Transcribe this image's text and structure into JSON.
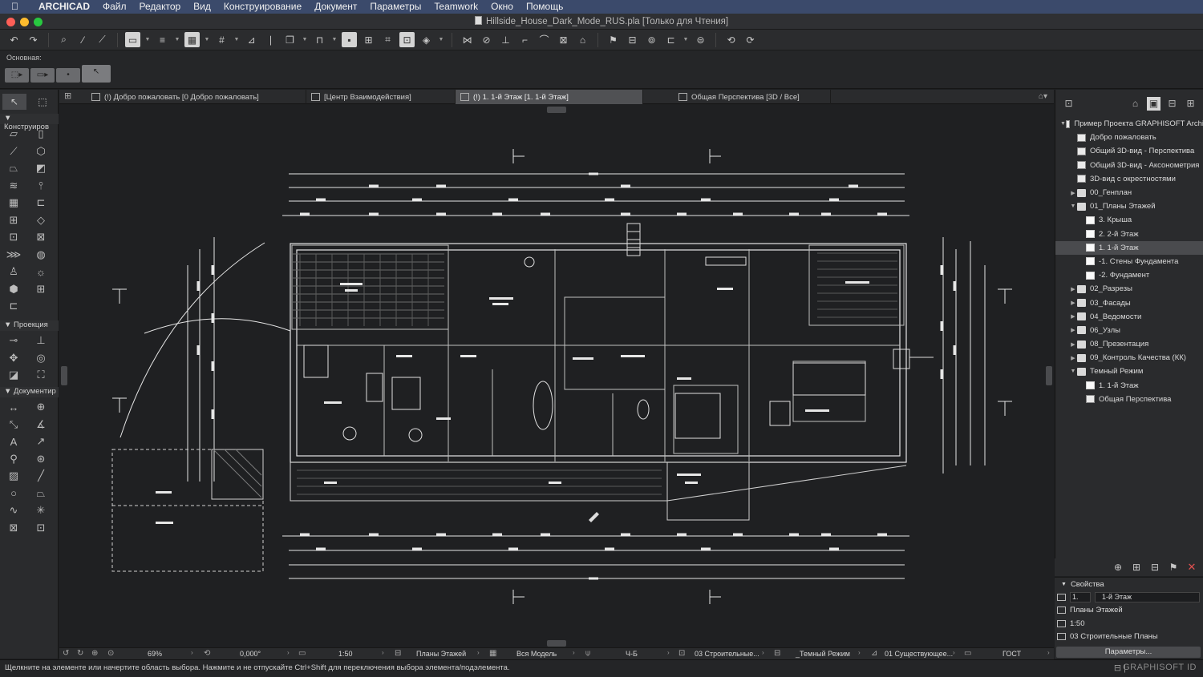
{
  "menubar": {
    "app": "ARCHICAD",
    "items": [
      "Файл",
      "Редактор",
      "Вид",
      "Конструирование",
      "Документ",
      "Параметры",
      "Teamwork",
      "Окно",
      "Помощь"
    ]
  },
  "window": {
    "title": "Hillside_House_Dark_Mode_RUS.pla [Только для Чтения]"
  },
  "infobox": {
    "label": "Основная:"
  },
  "toolbox": {
    "sections": [
      "Конструиров",
      "Проекция",
      "Документир"
    ]
  },
  "tabs": [
    {
      "label": "(!) Добро пожаловать [0 Добро пожаловать]",
      "active": false
    },
    {
      "label": "[Центр Взаимодействия]",
      "active": false
    },
    {
      "label": "(!) 1. 1-й Этаж [1. 1-й Этаж]",
      "active": true
    },
    {
      "label": "Общая Перспектива [3D / Все]",
      "active": false
    }
  ],
  "navigator": {
    "tree": [
      {
        "label": "Пример Проекта GRAPHISOFT Archi",
        "level": 0,
        "arrow": "▼",
        "icon": "view"
      },
      {
        "label": "Добро пожаловать",
        "level": 1,
        "arrow": "",
        "icon": "view"
      },
      {
        "label": "Общий 3D-вид - Перспектива",
        "level": 1,
        "arrow": "",
        "icon": "view"
      },
      {
        "label": "Общий 3D-вид - Аксонометрия",
        "level": 1,
        "arrow": "",
        "icon": "view"
      },
      {
        "label": "3D-вид с окрестностями",
        "level": 1,
        "arrow": "",
        "icon": "view"
      },
      {
        "label": "00_Генплан",
        "level": 1,
        "arrow": "▶",
        "icon": "folder"
      },
      {
        "label": "01_Планы Этажей",
        "level": 1,
        "arrow": "▼",
        "icon": "folder"
      },
      {
        "label": "3. Крыша",
        "level": 2,
        "arrow": "",
        "icon": "story"
      },
      {
        "label": "2. 2-й Этаж",
        "level": 2,
        "arrow": "",
        "icon": "story"
      },
      {
        "label": "1. 1-й Этаж",
        "level": 2,
        "arrow": "",
        "icon": "story",
        "selected": true
      },
      {
        "label": "-1. Стены Фундамента",
        "level": 2,
        "arrow": "",
        "icon": "story"
      },
      {
        "label": "-2. Фундамент",
        "level": 2,
        "arrow": "",
        "icon": "story"
      },
      {
        "label": "02_Разрезы",
        "level": 1,
        "arrow": "▶",
        "icon": "folder"
      },
      {
        "label": "03_Фасады",
        "level": 1,
        "arrow": "▶",
        "icon": "folder"
      },
      {
        "label": "04_Ведомости",
        "level": 1,
        "arrow": "▶",
        "icon": "folder"
      },
      {
        "label": "06_Узлы",
        "level": 1,
        "arrow": "▶",
        "icon": "folder"
      },
      {
        "label": "08_Презентация",
        "level": 1,
        "arrow": "▶",
        "icon": "folder"
      },
      {
        "label": "09_Контроль Качества (КК)",
        "level": 1,
        "arrow": "▶",
        "icon": "folder"
      },
      {
        "label": "Темный Режим",
        "level": 1,
        "arrow": "▼",
        "icon": "folder"
      },
      {
        "label": "1. 1-й Этаж",
        "level": 2,
        "arrow": "",
        "icon": "story"
      },
      {
        "label": "Общая Перспектива",
        "level": 2,
        "arrow": "",
        "icon": "view"
      }
    ]
  },
  "properties": {
    "header": "Свойства",
    "story_num": "1.",
    "story_name": "1-й Этаж",
    "rows": [
      "Планы Этажей",
      "1:50",
      "03 Строительные Планы"
    ],
    "button": "Параметры..."
  },
  "quick_options": {
    "zoom": "69%",
    "angle": "0,000°",
    "scale": "1:50",
    "layer_combo": "Планы Этажей",
    "model_view": "Вся Модель",
    "pen_set": "Ч-Б",
    "dimension": "03 Строительные...",
    "graphic_override": "_Темный Режим",
    "renovation": "01 Существующее...",
    "standard": "ГОСТ"
  },
  "status": {
    "message": "Щелкните на элементе или начертите область выбора. Нажмите и не отпускайте Ctrl+Shift для переключения выбора элемента/подэлемента.",
    "brand": "GRAPHISOFT ID"
  },
  "colors": {
    "menubar": "#3b4a6b",
    "background": "#1f2022",
    "drawing_lines": "#e6e6e6"
  }
}
